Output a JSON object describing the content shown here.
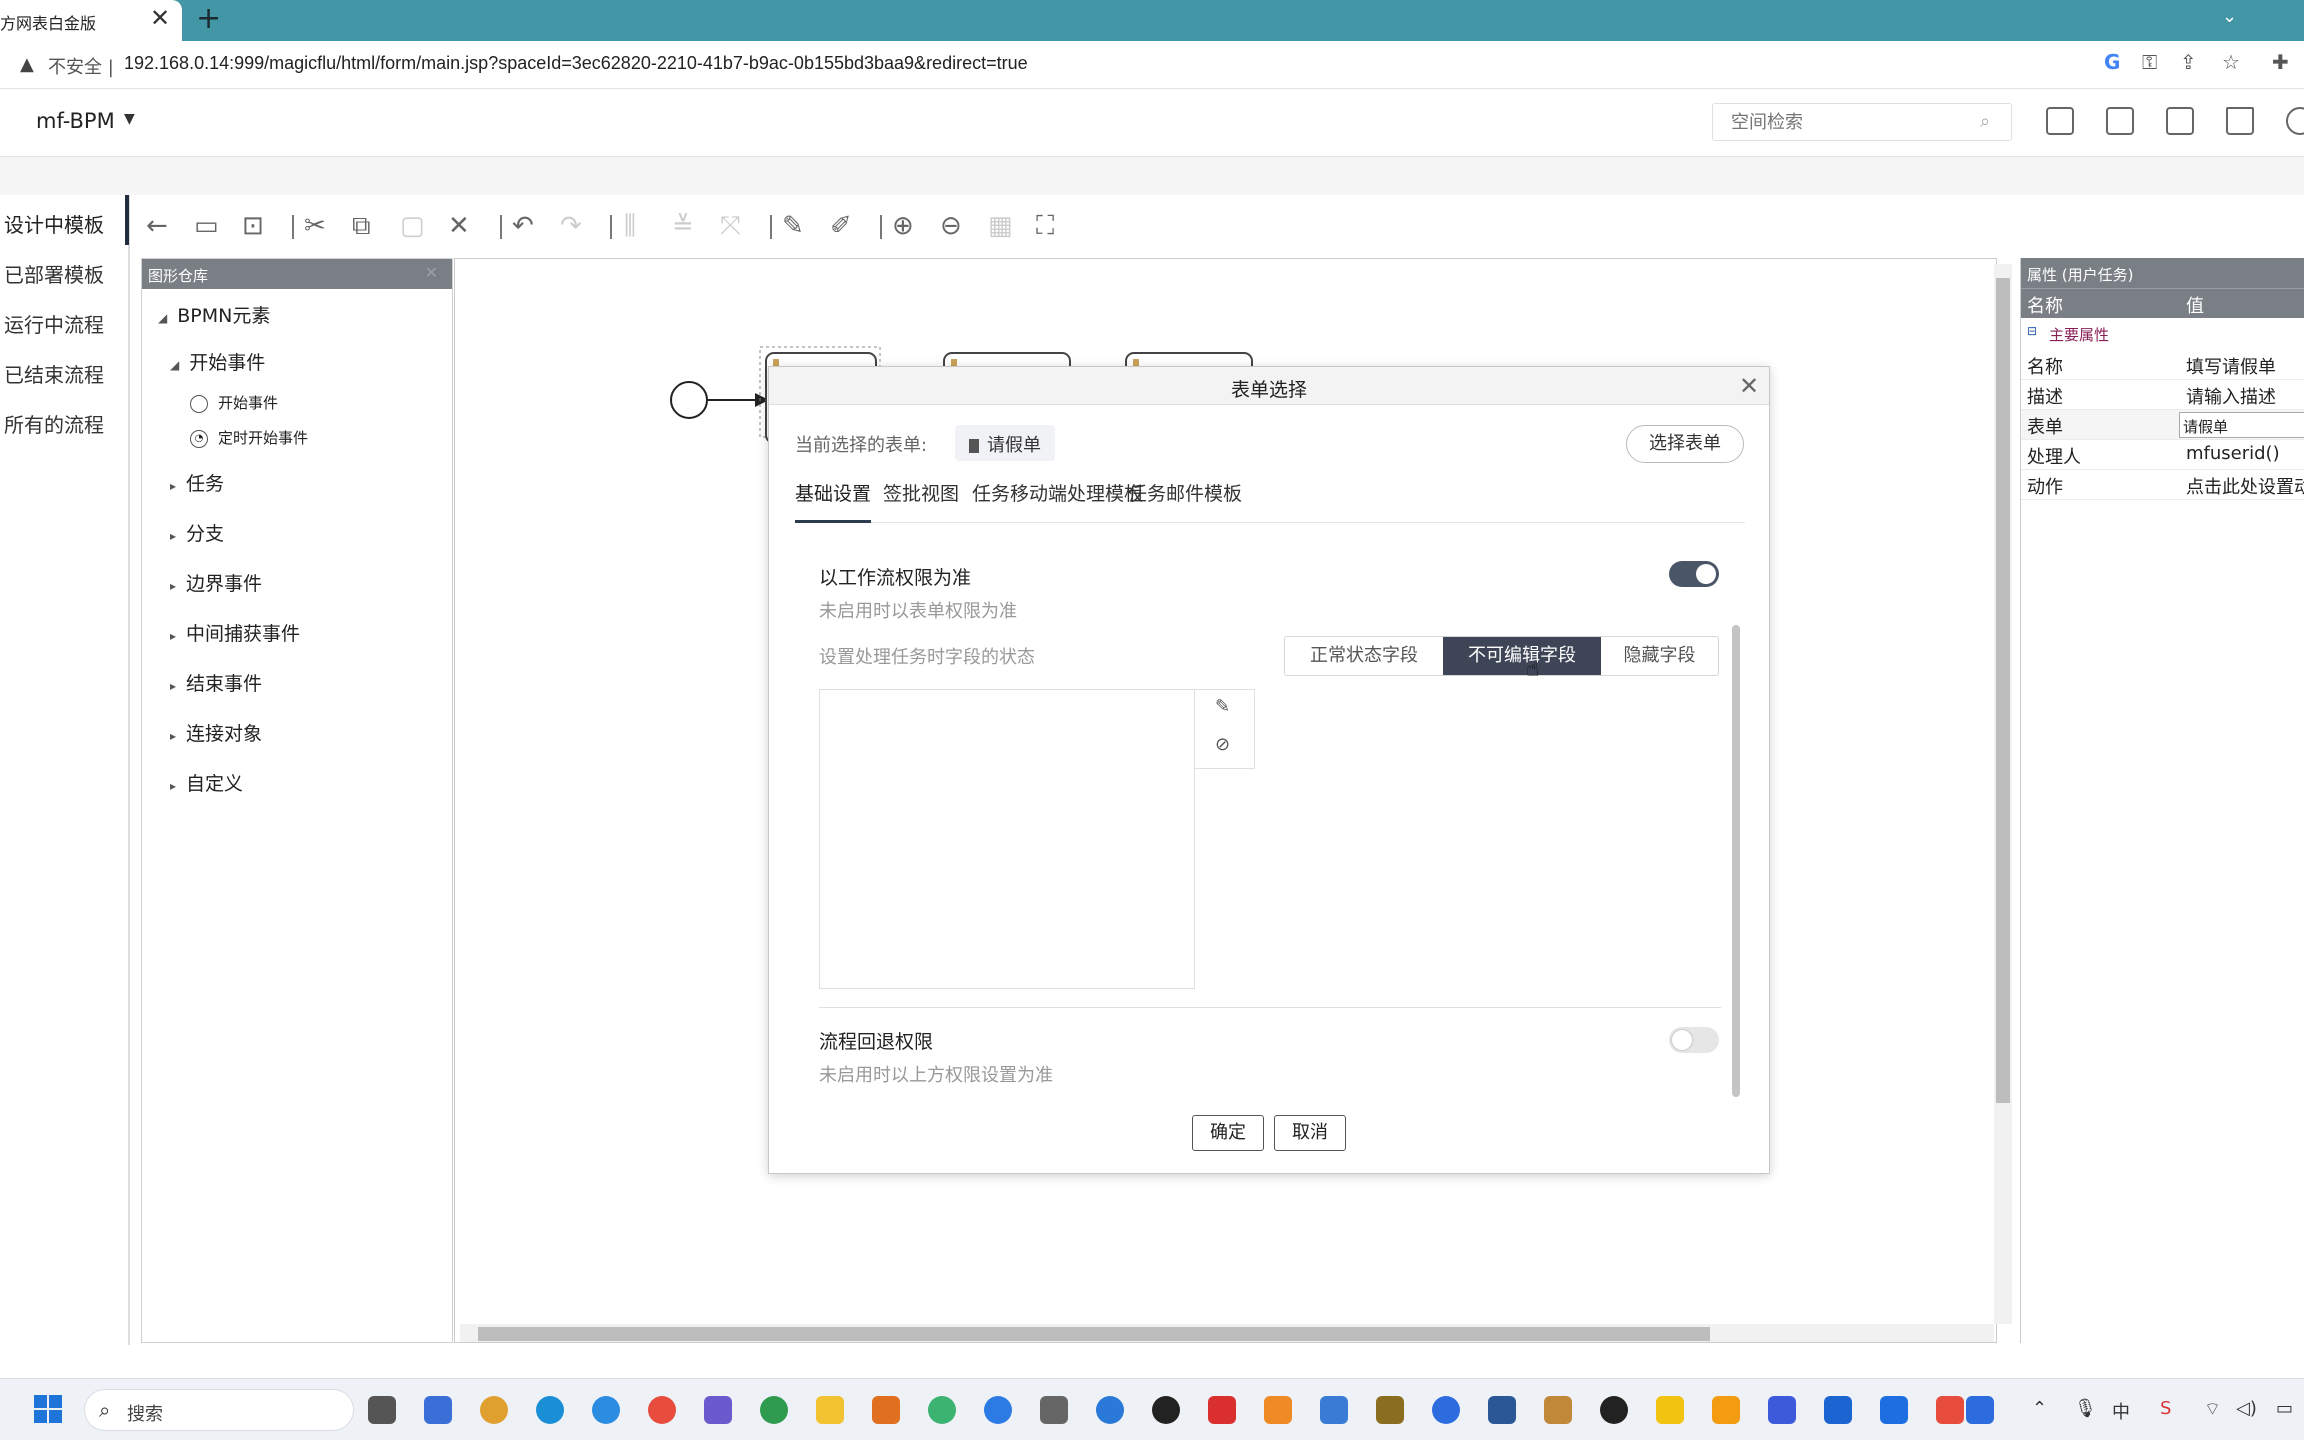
{
  "browser": {
    "tab_title": "方网表白金版",
    "tab_close": "✕",
    "new_tab": "+",
    "tab_menu": "⌄",
    "warning_icon": "▲",
    "insecure_label": "不安全 |",
    "url": "192.168.0.14:999/magicflu/html/form/main.jsp?spaceId=3ec62820-2210-41b7-b9ac-0b155bd3baa9&redirect=true",
    "icons": [
      "google-icon",
      "key-icon",
      "share-icon",
      "star-icon",
      "extensions-icon"
    ]
  },
  "header": {
    "app_name": "mf-BPM",
    "caret": "▼",
    "search_placeholder": "空间检索",
    "icons": [
      "help-icon",
      "mail-icon",
      "document-icon",
      "shirt-icon",
      "more-icon"
    ]
  },
  "nav": {
    "items": [
      "设计中模板",
      "已部署模板",
      "运行中流程",
      "已结束流程",
      "所有的流程"
    ],
    "active_index": 0
  },
  "toolbar": {
    "icons": [
      "back-icon",
      "save-icon",
      "save-as-icon",
      "cut-icon",
      "copy-icon",
      "paste-icon",
      "delete-icon",
      "undo-icon",
      "redo-icon",
      "align-vertical-icon",
      "align-horizontal-icon",
      "same-size-icon",
      "edge-add-icon",
      "edge-remove-icon",
      "zoom-in-icon",
      "zoom-out-icon",
      "zoom-actual-icon",
      "fit-icon"
    ]
  },
  "palette": {
    "header": "图形仓库",
    "close": "✕",
    "root": "BPMN元素",
    "start_group": "开始事件",
    "start_items": [
      "开始事件",
      "定时开始事件"
    ],
    "groups": [
      "任务",
      "分支",
      "边界事件",
      "中间捕获事件",
      "结束事件",
      "连接对象",
      "自定义"
    ]
  },
  "properties": {
    "header": "属性 (用户任务)",
    "col_name": "名称",
    "col_value": "值",
    "group": "主要属性",
    "rows": [
      {
        "key": "名称",
        "value": "填写请假单"
      },
      {
        "key": "描述",
        "value": "请输入描述"
      },
      {
        "key": "表单",
        "value": "请假单"
      },
      {
        "key": "处理人",
        "value": "mfuserid()"
      },
      {
        "key": "动作",
        "value": "点击此处设置动"
      }
    ]
  },
  "dialog": {
    "title": "表单选择",
    "close": "✕",
    "current_label": "当前选择的表单:",
    "current_form": "请假单",
    "select_button": "选择表单",
    "tabs": [
      "基础设置",
      "签批视图",
      "任务移动端处理模板",
      "任务邮件模板"
    ],
    "active_tab": 0,
    "workflow_perm_title": "以工作流权限为准",
    "workflow_perm_desc": "未启用时以表单权限为准",
    "workflow_perm_on": true,
    "field_status_label": "设置处理任务时字段的状态",
    "field_status_options": [
      "正常状态字段",
      "不可编辑字段",
      "隐藏字段"
    ],
    "field_status_selected": "不可编辑字段",
    "rollback_title": "流程回退权限",
    "rollback_desc": "未启用时以上方权限设置为准",
    "rollback_on": false,
    "ok": "确定",
    "cancel": "取消"
  },
  "taskbar": {
    "search": "搜索",
    "tray_ime": "中"
  }
}
